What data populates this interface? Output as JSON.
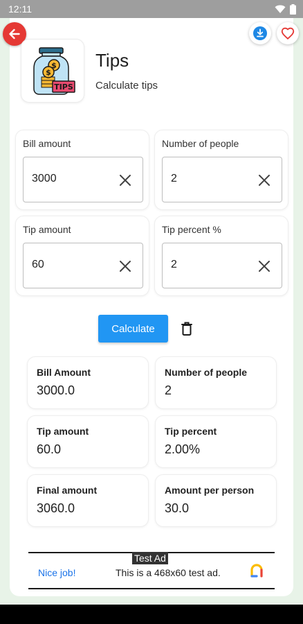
{
  "status_bar": {
    "time": "12:11"
  },
  "app": {
    "title": "Tips",
    "subtitle": "Calculate tips",
    "icon_label": "TIPS"
  },
  "inputs": [
    {
      "label": "Bill amount",
      "value": "3000"
    },
    {
      "label": "Number of people",
      "value": "2"
    },
    {
      "label": "Tip amount",
      "value": "60"
    },
    {
      "label": "Tip percent %",
      "value": "2"
    }
  ],
  "actions": {
    "calculate": "Calculate"
  },
  "results": [
    {
      "label": "Bill Amount",
      "value": "3000.0"
    },
    {
      "label": "Number of people",
      "value": "2"
    },
    {
      "label": "Tip amount",
      "value": "60.0"
    },
    {
      "label": "Tip percent",
      "value": "2.00%"
    },
    {
      "label": "Final amount",
      "value": "3060.0"
    },
    {
      "label": "Amount per person",
      "value": "30.0"
    }
  ],
  "ad": {
    "tag": "Test Ad",
    "cta": "Nice job!",
    "text": "This is a 468x60 test ad."
  },
  "colors": {
    "accent": "#2196f3",
    "back": "#e53935",
    "favorite": "#e53935",
    "download": "#1e88e5"
  }
}
